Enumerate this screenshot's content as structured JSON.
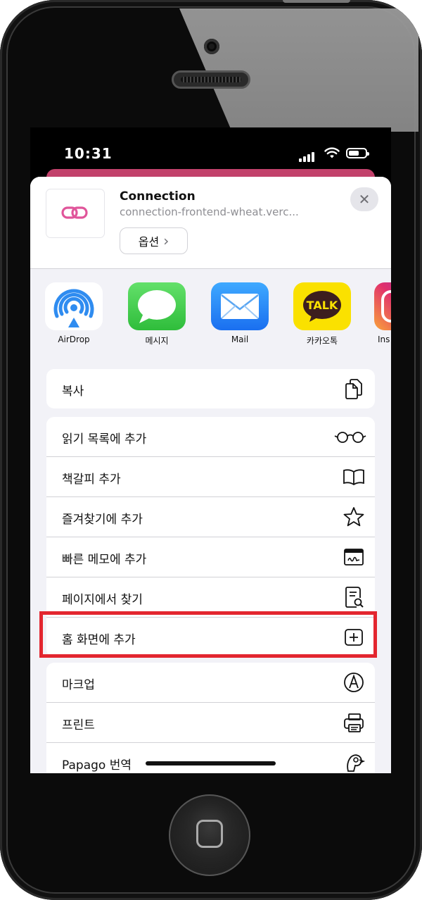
{
  "status": {
    "time": "10:31"
  },
  "share_header": {
    "title": "Connection",
    "url": "connection-frontend-wheat.verc...",
    "options_label": "옵션",
    "options_chevron": "›",
    "close_glyph": "✕"
  },
  "apps": [
    {
      "label": "AirDrop",
      "icon": "airdrop-icon"
    },
    {
      "label": "메시지",
      "icon": "messages-icon"
    },
    {
      "label": "Mail",
      "icon": "mail-icon"
    },
    {
      "label": "카카오톡",
      "icon": "kakaotalk-icon",
      "badge_text": "TALK"
    },
    {
      "label": "Ins",
      "icon": "instagram-icon"
    }
  ],
  "actions_group1": [
    {
      "label": "복사",
      "icon": "copy-icon"
    }
  ],
  "actions_group2": [
    {
      "label": "읽기 목록에 추가",
      "icon": "glasses-icon"
    },
    {
      "label": "책갈피 추가",
      "icon": "book-icon"
    },
    {
      "label": "즐겨찾기에 추가",
      "icon": "star-icon"
    },
    {
      "label": "빠른 메모에 추가",
      "icon": "quick-note-icon"
    },
    {
      "label": "페이지에서 찾기",
      "icon": "find-on-page-icon"
    },
    {
      "label": "홈 화면에 추가",
      "icon": "add-square-icon"
    }
  ],
  "actions_group3": [
    {
      "label": "마크업",
      "icon": "markup-icon"
    },
    {
      "label": "프린트",
      "icon": "printer-icon"
    },
    {
      "label": "Papago 번역",
      "icon": "papago-icon"
    }
  ],
  "colors": {
    "accent_pink": "#c2416b",
    "highlight_red": "#e3262f",
    "sheet_bg": "#f2f2f7"
  }
}
